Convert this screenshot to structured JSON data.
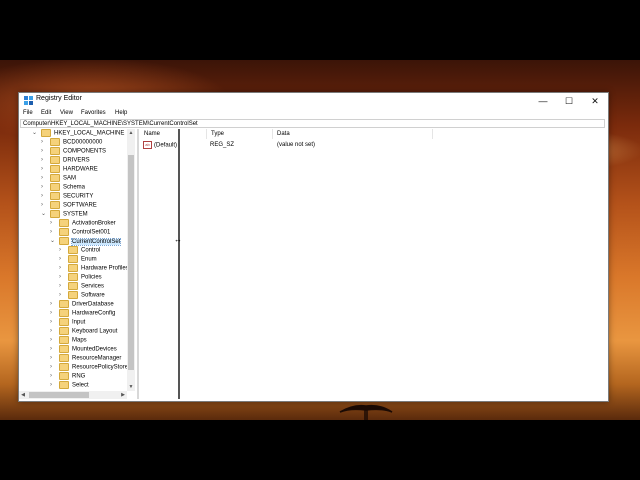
{
  "window": {
    "title": "Registry Editor",
    "controls": {
      "minimize": "—",
      "maximize": "☐",
      "close": "✕"
    }
  },
  "menu": [
    "File",
    "Edit",
    "View",
    "Favorites",
    "Help"
  ],
  "address": "Computer\\HKEY_LOCAL_MACHINE\\SYSTEM\\CurrentControlSet",
  "tree": {
    "root": "HKEY_LOCAL_MACHINE",
    "level1": [
      "BCD00000000",
      "COMPONENTS",
      "DRIVERS",
      "HARDWARE",
      "SAM",
      "Schema",
      "SECURITY",
      "SOFTWARE",
      "SYSTEM"
    ],
    "system_children": [
      "ActivationBroker",
      "ControlSet001",
      "CurrentControlSet"
    ],
    "ccs_children": [
      "Control",
      "Enum",
      "Hardware Profiles",
      "Policies",
      "Services",
      "Software"
    ],
    "system_more": [
      "DriverDatabase",
      "HardwareConfig",
      "Input",
      "Keyboard Layout",
      "Maps",
      "MountedDevices",
      "ResourceManager",
      "ResourcePolicyStore",
      "RNG",
      "Select"
    ],
    "selected": "CurrentControlSet"
  },
  "columns": {
    "name": "Name",
    "type": "Type",
    "data": "Data"
  },
  "values": [
    {
      "name": "(Default)",
      "type": "REG_SZ",
      "data": "(value not set)",
      "icon": "ab"
    }
  ],
  "colors": {
    "selection": "#cce8ff",
    "folder": "#f5d27b"
  }
}
